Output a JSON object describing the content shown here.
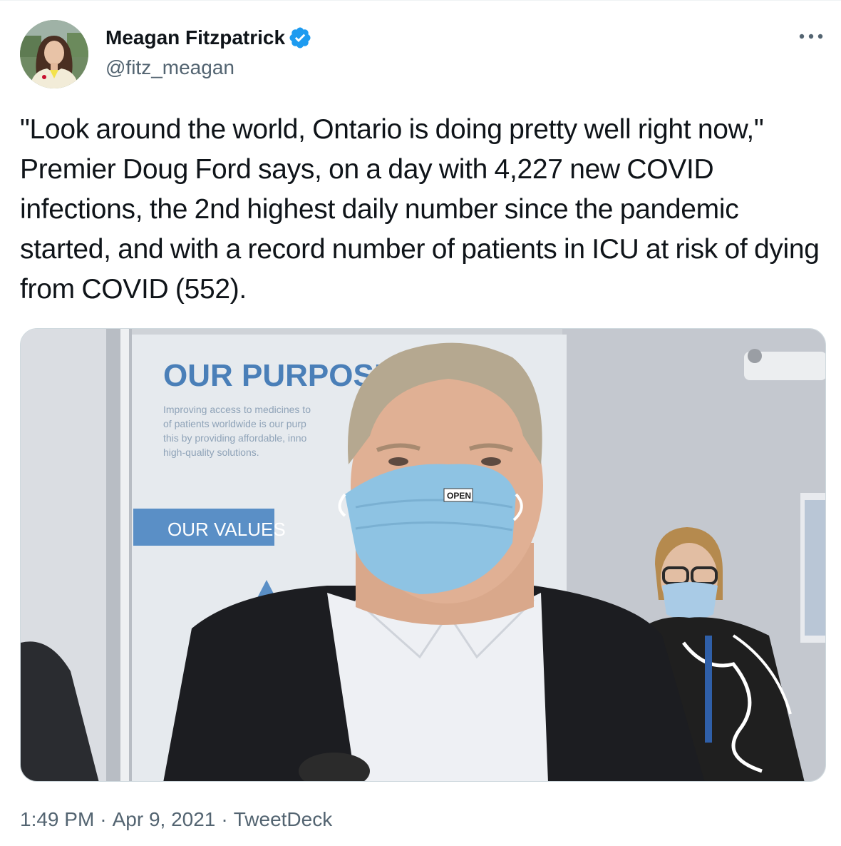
{
  "author": {
    "display_name": "Meagan Fitzpatrick",
    "handle": "@fitz_meagan",
    "verified": true
  },
  "tweet": {
    "text": "\"Look around the world, Ontario is doing pretty well right now,\" Premier Doug Ford says, on a day with 4,227 new COVID infections, the 2nd highest daily number since the pandemic started, and with a record number of patients in ICU at risk of dying from COVID (552)."
  },
  "media": {
    "poster_heading": "OUR PURPOSE",
    "poster_body": [
      "Improving access to medicines to",
      "of patients worldwide is our purp",
      "this by providing affordable, inno",
      "high-quality solutions."
    ],
    "poster_values": "OUR VALUES",
    "mask_tag": "OPEN"
  },
  "meta": {
    "time": "1:49 PM",
    "separator": "·",
    "date": "Apr 9, 2021",
    "source": "TweetDeck"
  },
  "colors": {
    "verified_blue": "#1d9bf0",
    "secondary_text": "#536471",
    "primary_text": "#0f1419",
    "border": "#cfd9de"
  },
  "icons": {
    "verified": "verified-badge-icon",
    "more": "more-dots-icon"
  }
}
